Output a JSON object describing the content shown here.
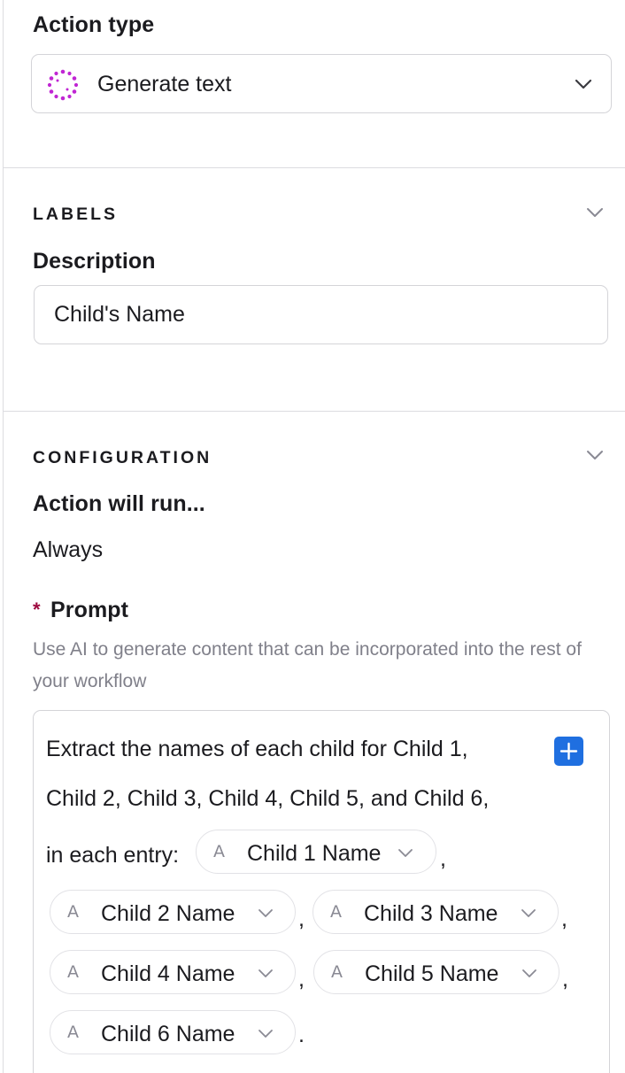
{
  "action_type": {
    "label": "Action type",
    "selected": "Generate text",
    "icon": "ai-sparkle-icon",
    "icon_color": "#c026d3"
  },
  "labels_section": {
    "title": "LABELS",
    "description_label": "Description",
    "description_value": "Child's Name"
  },
  "configuration_section": {
    "title": "CONFIGURATION",
    "run_label": "Action will run...",
    "run_value": "Always",
    "prompt_required_mark": "*",
    "prompt_label": "Prompt",
    "prompt_help": "Use AI to generate content that can be incorporated into the rest of your workflow",
    "prompt_lines": [
      "Extract the names of each child for Child 1,",
      "Child 2, Child 3, Child 4, Child 5, and Child 6,",
      "in each entry:"
    ],
    "tokens": [
      "Child 1 Name",
      "Child 2 Name",
      "Child 3 Name",
      "Child 4 Name",
      "Child 5 Name",
      "Child 6 Name"
    ],
    "separator": ",",
    "terminator": ".",
    "token_icon": "A",
    "add_button_color": "#1f6fe0"
  }
}
